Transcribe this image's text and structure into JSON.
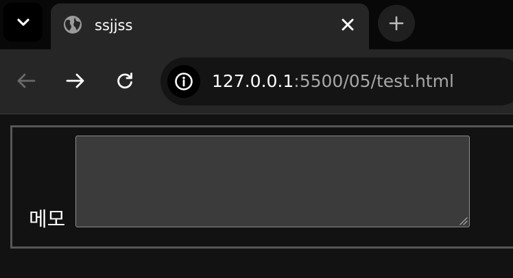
{
  "browser": {
    "tab": {
      "title": "ssjjss"
    },
    "address_bar": {
      "host": "127.0.0.1",
      "rest": ":5500/05/test.html"
    },
    "icons": {
      "tab_search": "chevron-down-icon",
      "favicon": "globe-icon",
      "close_tab": "close-icon",
      "new_tab": "plus-icon",
      "back": "arrow-left-icon",
      "forward": "arrow-right-icon",
      "reload": "reload-icon",
      "site_info": "info-icon"
    }
  },
  "page": {
    "memo_label": "메모",
    "memo_value": ""
  }
}
